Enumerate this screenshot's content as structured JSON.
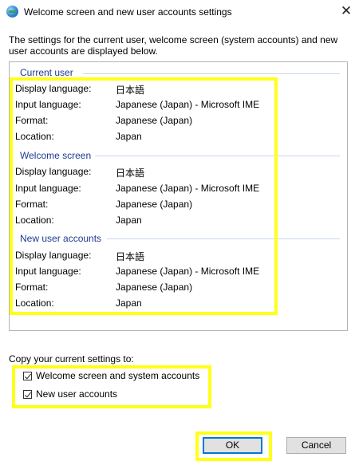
{
  "window": {
    "title": "Welcome screen and new user accounts settings",
    "close_glyph": "✕"
  },
  "description": "The settings for the current user, welcome screen (system accounts) and new user accounts are displayed below.",
  "groups": [
    {
      "header": "Current user",
      "rows": [
        {
          "label": "Display language:",
          "value": "日本語"
        },
        {
          "label": "Input language:",
          "value": "Japanese (Japan) - Microsoft IME"
        },
        {
          "label": "Format:",
          "value": "Japanese (Japan)"
        },
        {
          "label": "Location:",
          "value": "Japan"
        }
      ]
    },
    {
      "header": "Welcome screen",
      "rows": [
        {
          "label": "Display language:",
          "value": "日本語"
        },
        {
          "label": "Input language:",
          "value": "Japanese (Japan) - Microsoft IME"
        },
        {
          "label": "Format:",
          "value": "Japanese (Japan)"
        },
        {
          "label": "Location:",
          "value": "Japan"
        }
      ]
    },
    {
      "header": "New user accounts",
      "rows": [
        {
          "label": "Display language:",
          "value": "日本語"
        },
        {
          "label": "Input language:",
          "value": "Japanese (Japan) - Microsoft IME"
        },
        {
          "label": "Format:",
          "value": "Japanese (Japan)"
        },
        {
          "label": "Location:",
          "value": "Japan"
        }
      ]
    }
  ],
  "copy_settings": {
    "label": "Copy your current settings to:",
    "options": [
      {
        "label": "Welcome screen and system accounts",
        "checked": true
      },
      {
        "label": "New user accounts",
        "checked": true
      }
    ]
  },
  "buttons": {
    "ok": "OK",
    "cancel": "Cancel"
  },
  "colors": {
    "highlight": "#ffff1a",
    "group_header": "#1e3a94",
    "ok_border": "#0078d7"
  }
}
